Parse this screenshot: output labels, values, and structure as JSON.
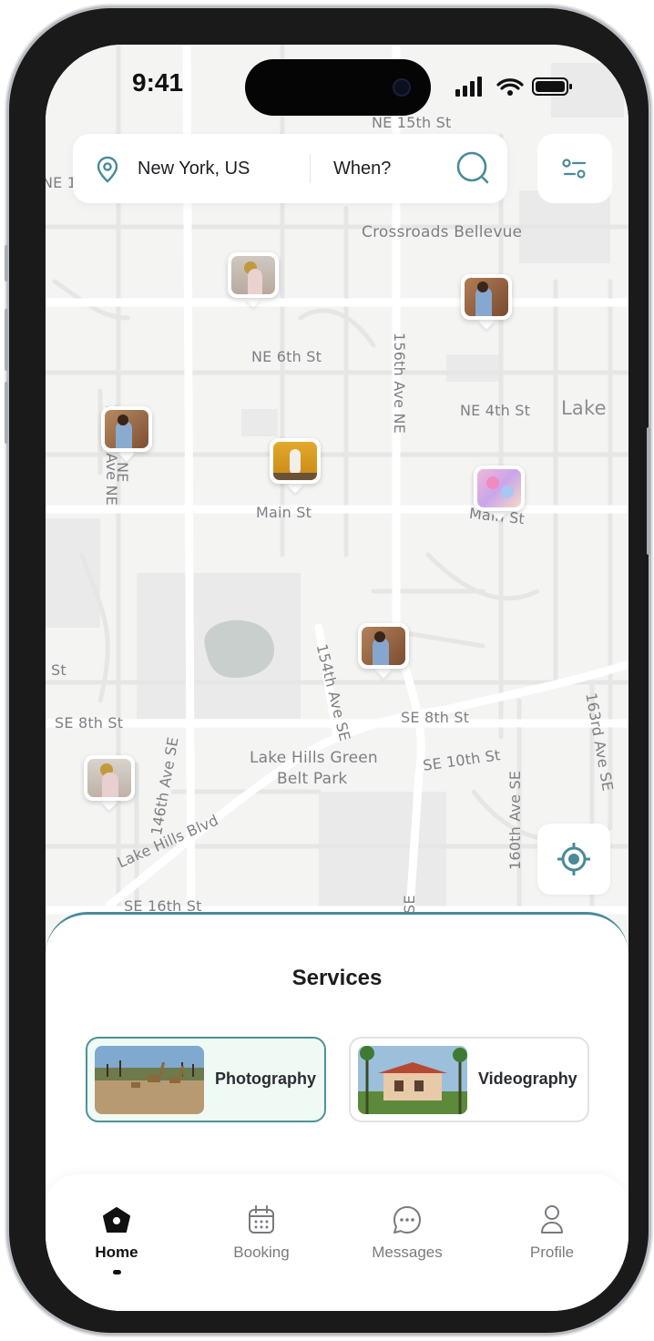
{
  "status": {
    "time": "9:41"
  },
  "search": {
    "location": "New York, US",
    "when_placeholder": "When?"
  },
  "map": {
    "labels": {
      "ne15": "NE 15th St",
      "ne1": "NE 1",
      "crossroads": "Crossroads Bellevue",
      "ave148": "148th Ave NE",
      "ave156": "156th Ave NE",
      "ne6": "NE 6th St",
      "ne4": "NE 4th St",
      "lake": "Lake",
      "ne_small": "NE",
      "main1": "Main St",
      "main2": "Main St",
      "st_left": "St",
      "ave154": "154th Ave SE",
      "se8a": "SE 8th St",
      "se8b": "SE 8th St",
      "ave163": "163rd Ave SE",
      "park1": "Lake Hills Green",
      "park2": "Belt Park",
      "se10": "SE 10th St",
      "ave146": "146th Ave SE",
      "ave160": "160th Ave SE",
      "blvd": "Lake Hills Blvd",
      "se16": "SE 16th St",
      "se_small": "SE"
    }
  },
  "services": {
    "title": "Services",
    "items": [
      {
        "label": "Photography",
        "selected": true
      },
      {
        "label": "Videography",
        "selected": false
      }
    ]
  },
  "tabs": [
    {
      "label": "Home",
      "icon": "home-icon",
      "active": true
    },
    {
      "label": "Booking",
      "icon": "calendar-icon",
      "active": false
    },
    {
      "label": "Messages",
      "icon": "chat-icon",
      "active": false
    },
    {
      "label": "Profile",
      "icon": "user-icon",
      "active": false
    }
  ],
  "colors": {
    "accent": "#4a8a99",
    "selected_bg": "#effaf4",
    "map_bg": "#f4f4f3"
  }
}
